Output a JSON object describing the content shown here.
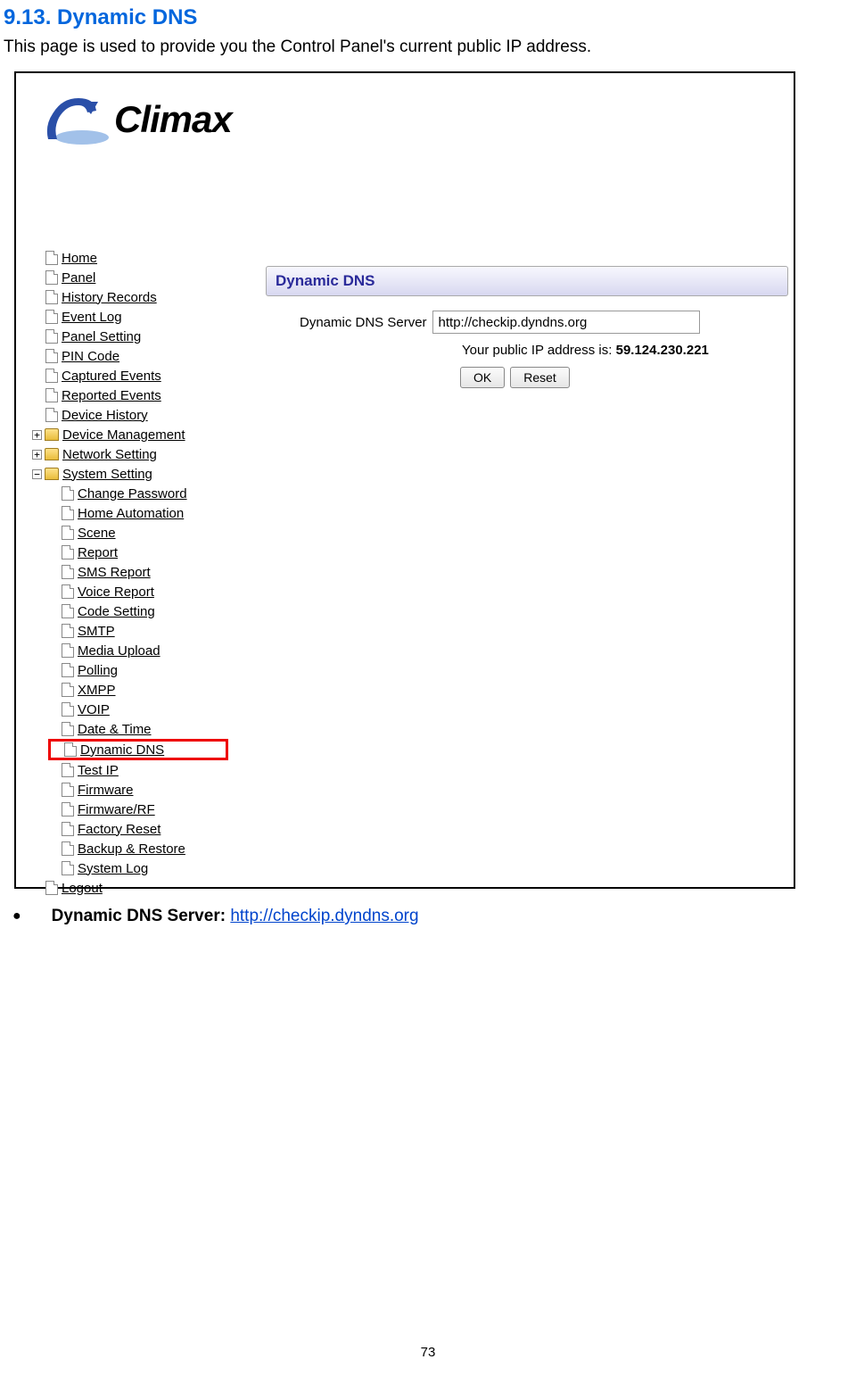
{
  "section_heading": "9.13. Dynamic DNS",
  "intro_text": "This page is used to provide you the Control Panel's current public IP address.",
  "logo_text": "Climax",
  "panel_title": "Dynamic DNS",
  "form": {
    "label": "Dynamic DNS Server",
    "value": "http://checkip.dyndns.org",
    "ip_prefix": "Your public IP address is: ",
    "ip_value": "59.124.230.221",
    "ok_button": "OK",
    "reset_button": "Reset"
  },
  "tree": {
    "items": [
      "Home",
      "Panel",
      "History Records",
      "Event Log",
      "Panel Setting",
      "PIN Code",
      "Captured Events",
      "Reported Events",
      "Device History"
    ],
    "device_management": "Device Management",
    "network_setting": "Network Setting",
    "system_setting": "System Setting",
    "system_children": [
      "Change Password",
      "Home Automation",
      "Scene",
      "Report",
      "SMS Report",
      "Voice Report",
      "Code Setting",
      "SMTP",
      "Media Upload",
      "Polling",
      "XMPP",
      "VOIP",
      "Date & Time",
      "Dynamic DNS",
      "Test IP",
      "Firmware",
      "Firmware/RF",
      "Factory Reset",
      "Backup & Restore",
      "System Log"
    ],
    "logout": "Logout"
  },
  "glyphs": {
    "plus": "+",
    "minus": "−"
  },
  "bullet": {
    "label": "Dynamic DNS Server: ",
    "link": "http://checkip.dyndns.org"
  },
  "page_number": "73"
}
